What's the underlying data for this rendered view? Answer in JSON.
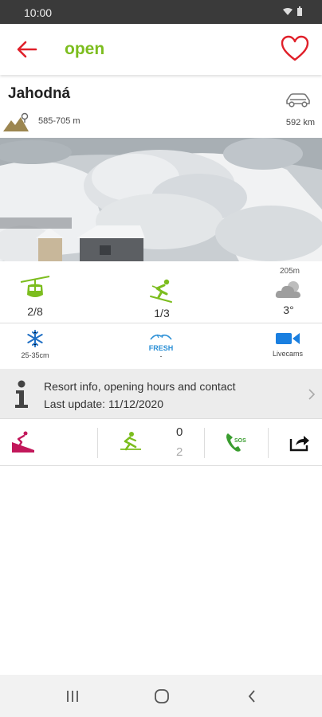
{
  "statusbar": {
    "time": "10:00"
  },
  "header": {
    "status": "open"
  },
  "resort": {
    "name": "Jahodná",
    "altitude": "585-705 m",
    "distance": "592 km"
  },
  "stats": {
    "lifts": "2/8",
    "slopes": "1/3",
    "weather_altitude": "205m",
    "temperature": "3°"
  },
  "conditions": {
    "snow_depth": "25-35cm",
    "snow_type": "FRESH",
    "snow_type_sub": "-",
    "livecams": "Livecams"
  },
  "info": {
    "title": "Resort info, opening hours and contact",
    "last_update": "Last update: 11/12/2020"
  },
  "actions": {
    "count_open": "0",
    "count_total": "2"
  },
  "colors": {
    "accent_green": "#7cbd1e",
    "accent_red": "#e0202a",
    "snow_blue": "#1f6fc4",
    "cam_blue": "#1a7fe0",
    "slope_magenta": "#c2185b",
    "status_bar": "#3a3a3a"
  },
  "icons": [
    "back-arrow-icon",
    "heart-icon",
    "mountain-pin-icon",
    "car-icon",
    "gondola-icon",
    "skier-icon",
    "cloud-icon",
    "snowflake-icon",
    "fresh-snow-icon",
    "camera-icon",
    "info-icon",
    "chevron-right-icon",
    "slope-icon",
    "crosscountry-ski-icon",
    "sos-phone-icon",
    "share-icon"
  ]
}
